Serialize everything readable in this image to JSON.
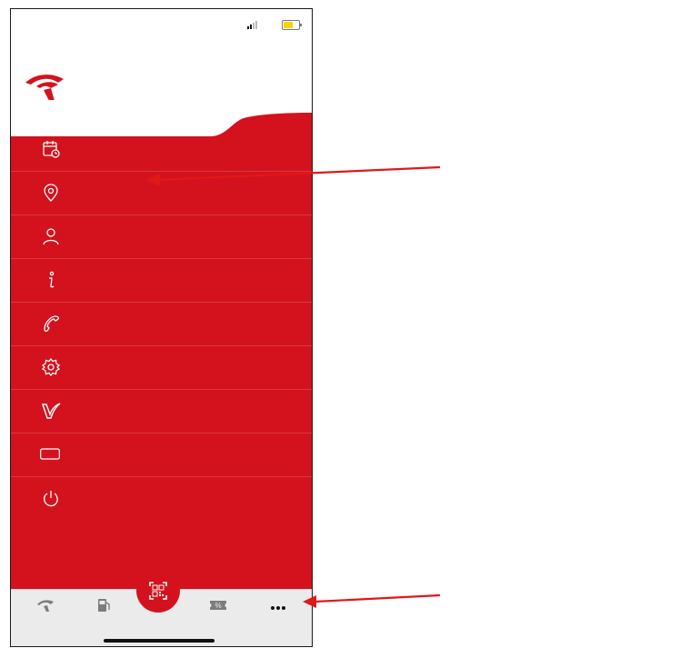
{
  "status": {
    "time": "",
    "back_app": "",
    "network": ""
  },
  "menu": {
    "items": [
      {
        "label": "",
        "icon": "calendar-icon"
      },
      {
        "label": "",
        "icon": "location-pin-icon"
      },
      {
        "label": "",
        "icon": "person-icon"
      },
      {
        "label": "",
        "icon": "info-icon"
      },
      {
        "label": "",
        "icon": "phone-icon"
      },
      {
        "label": "",
        "icon": "gear-icon"
      },
      {
        "label": "",
        "icon": "vitay-icon"
      },
      {
        "label": "",
        "icon": "flota-icon"
      },
      {
        "label": "",
        "icon": "power-icon"
      }
    ]
  },
  "tabbar": {
    "tabs": [
      {
        "label": "",
        "icon": "orlen-eagle-icon"
      },
      {
        "label": "",
        "icon": "fuel-pump-icon"
      },
      {
        "label": "",
        "icon": "qr-code-icon"
      },
      {
        "label": "",
        "icon": "coupon-icon"
      },
      {
        "label": "",
        "icon": "more-icon"
      }
    ],
    "flota_badge": ""
  },
  "annotations": {
    "ebilet": {
      "prefix": "",
      "bold": "",
      "suffix": ""
    },
    "more": {
      "bold": "",
      "rest": ""
    }
  },
  "colors": {
    "brand_red": "",
    "battery": ""
  }
}
